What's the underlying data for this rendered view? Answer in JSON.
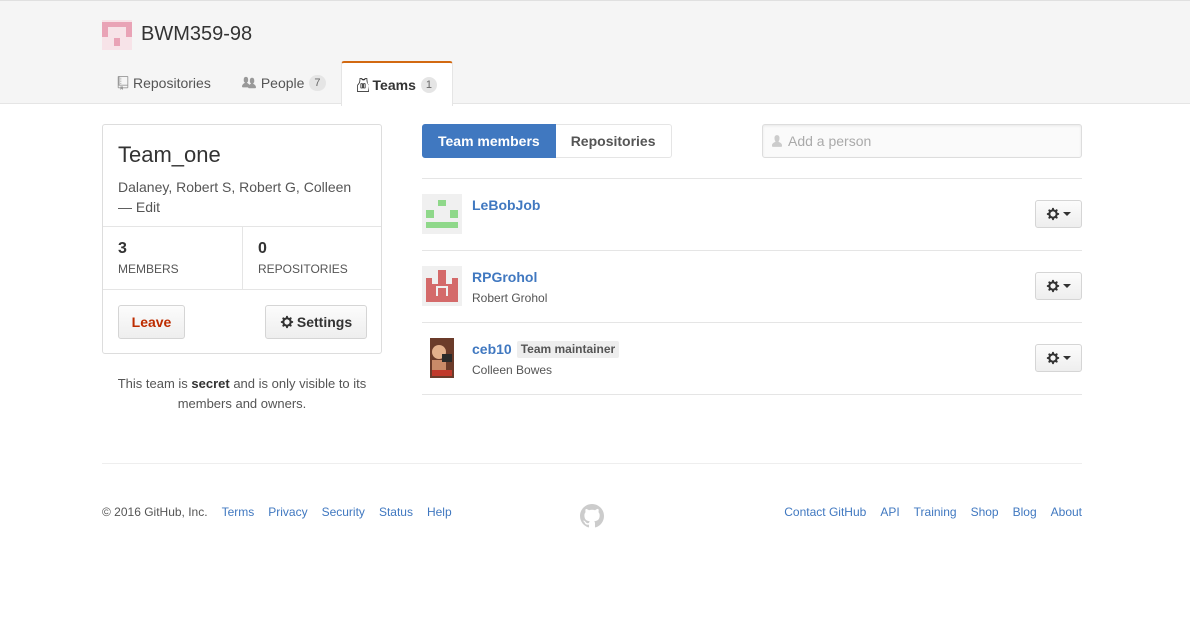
{
  "org": {
    "name": "BWM359-98",
    "avatar_icon": "org-identicon",
    "tabs": [
      {
        "label": "Repositories",
        "icon": "repo-icon",
        "count": ""
      },
      {
        "label": "People",
        "icon": "people-icon",
        "count": "7"
      },
      {
        "label": "Teams",
        "icon": "jersey-icon",
        "count": "1",
        "selected": true
      }
    ]
  },
  "team": {
    "name": "Team_one",
    "description": "Dalaney, Robert S, Robert G, Colleen",
    "edit_label": "— Edit",
    "stats": [
      {
        "value": "3",
        "label": "MEMBERS"
      },
      {
        "value": "0",
        "label": "REPOSITORIES"
      }
    ],
    "leave_label": "Leave",
    "settings_label": "Settings",
    "secret_note": {
      "prefix": "This team is ",
      "emphasis": "secret",
      "suffix": " and is only visible to its members and owners."
    }
  },
  "subnav": {
    "items": [
      "Team members",
      "Repositories"
    ],
    "selected": "Team members"
  },
  "add_person": {
    "placeholder": "Add a person"
  },
  "members": [
    {
      "login": "LeBobJob",
      "full_name": "",
      "badge": "",
      "avatar": "green-identicon"
    },
    {
      "login": "RPGrohol",
      "full_name": "Robert Grohol",
      "badge": "",
      "avatar": "red-identicon"
    },
    {
      "login": "ceb10",
      "full_name": "Colleen Bowes",
      "badge": "Team maintainer",
      "avatar": "photo-avatar"
    }
  ],
  "footer": {
    "copyright": "© 2016 GitHub, Inc.",
    "left_links": [
      "Terms",
      "Privacy",
      "Security",
      "Status",
      "Help"
    ],
    "right_links": [
      "Contact GitHub",
      "API",
      "Training",
      "Shop",
      "Blog",
      "About"
    ],
    "mark_icon": "octocat-icon"
  },
  "colors": {
    "accent": "#4078c0",
    "tab_highlight": "#d26911",
    "leave_red": "#bd2c00"
  }
}
